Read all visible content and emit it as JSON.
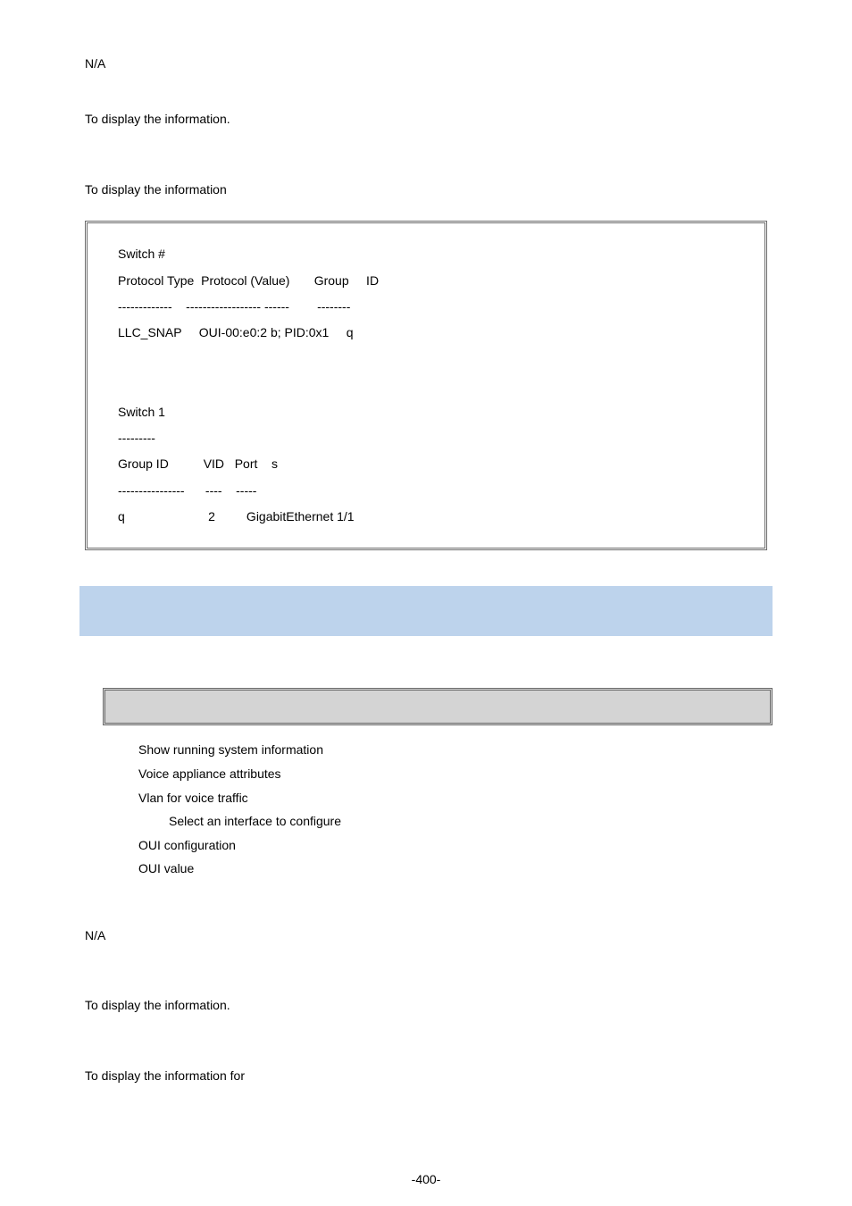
{
  "top": {
    "default_value": "N/A",
    "usage_before": "To display the ",
    "usage_after": " information.",
    "example_before": "To display the ",
    "example_after": " information"
  },
  "code": {
    "text": "Switch #\nProtocol Type  Protocol (Value)       Group     ID\n-------------    ------------------ ------        --------\nLLC_SNAP     OUI-00:e0:2 b; PID:0x1     q\n\n\nSwitch 1\n---------\nGroup ID          VID   Port    s\n----------------      ----    -----\nq                        2         GigabitEthernet 1/1"
  },
  "help": {
    "items": [
      {
        "indent": 0,
        "text": "Show running system information"
      },
      {
        "indent": 0,
        "text": "Voice appliance attributes"
      },
      {
        "indent": 0,
        "text": "Vlan for voice traffic"
      },
      {
        "indent": 1,
        "text": "Select an interface to configure"
      },
      {
        "indent": 0,
        "text": "OUI configuration"
      },
      {
        "indent": 0,
        "text": " OUI value"
      }
    ]
  },
  "bottom": {
    "default_value": "N/A",
    "usage_before": "To display the ",
    "usage_after": " information.",
    "example_before": "To display the ",
    "example_after": " information for"
  },
  "page_number": "-400-"
}
